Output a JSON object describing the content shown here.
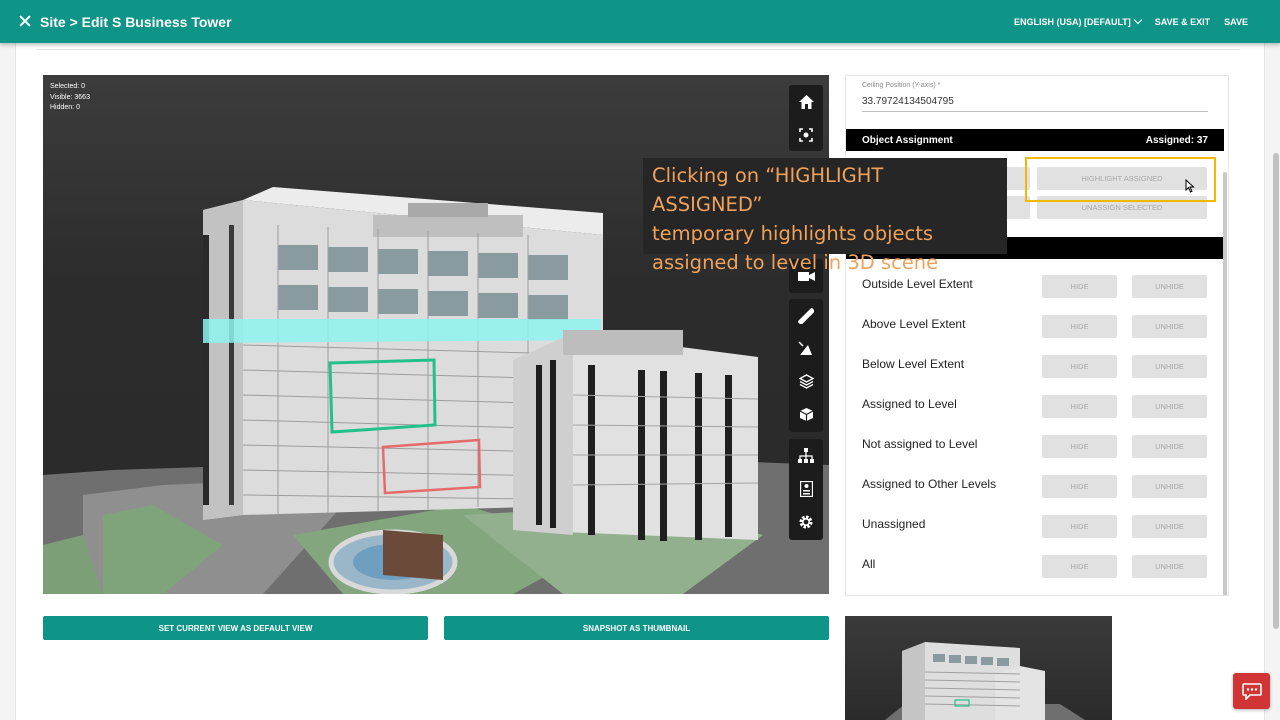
{
  "header": {
    "title": "Site > Edit S Business Tower",
    "language": "ENGLISH (USA) [DEFAULT]",
    "save_exit": "SAVE & EXIT",
    "save": "SAVE"
  },
  "viewer": {
    "selected": "Selected: 0",
    "visible": "Visible: 3663",
    "hidden": "Hidden: 0",
    "tools": [
      "home-icon",
      "fit-view-icon",
      "camera-icon",
      "measure-icon",
      "section-icon",
      "layers-icon",
      "model-icon",
      "tree-icon",
      "properties-icon",
      "settings-icon"
    ]
  },
  "buttons": {
    "default_view": "SET CURRENT VIEW AS DEFAULT VIEW",
    "snapshot": "SNAPSHOT AS THUMBNAIL"
  },
  "panel": {
    "ceiling_label": "Ceiling Position (Y-axis) *",
    "ceiling_value": "33.79724134504795",
    "object_assignment": "Object Assignment",
    "assigned_count": "Assigned: 37",
    "highlight_assigned": "HIGHLIGHT ASSIGNED",
    "unassign_selected": "UNASSIGN SELECTED",
    "hide_label": "HIDE",
    "unhide_label": "UNHIDE",
    "rows": [
      "Outside Level Extent",
      "Above Level Extent",
      "Below Level Extent",
      "Assigned to Level",
      "Not assigned to Level",
      "Assigned to Other Levels",
      "Unassigned",
      "All"
    ]
  },
  "annotation": {
    "line1": "Clicking on “HIGHLIGHT ASSIGNED”",
    "line2": "temporary highlights objects",
    "line3": "assigned to level in 3D scene"
  },
  "colors": {
    "brand": "#0f9488",
    "annotation_text": "#f0a15a",
    "highlight_box": "#f5b800",
    "level_highlight": "#8ef3f0",
    "chat": "#d13434"
  }
}
